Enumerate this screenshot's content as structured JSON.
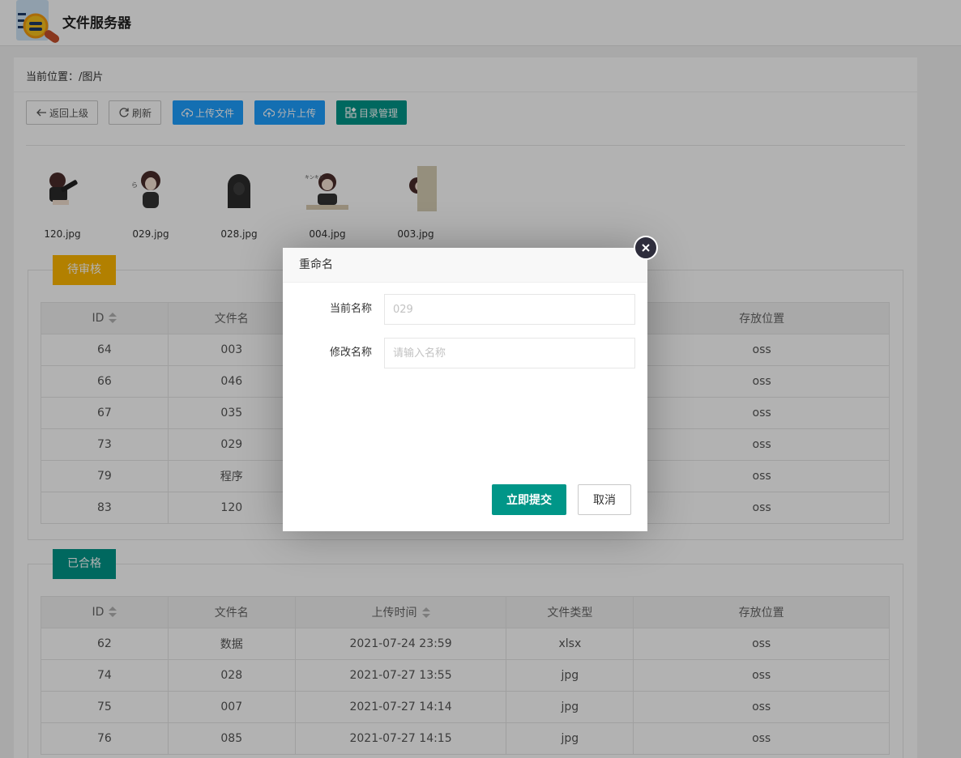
{
  "header": {
    "title": "文件服务器"
  },
  "breadcrumb": {
    "label": "当前位置：",
    "path": "/图片"
  },
  "toolbar": {
    "back": "返回上级",
    "refresh": "刷新",
    "upload": "上传文件",
    "chunk_upload": "分片上传",
    "dir_manage": "目录管理"
  },
  "thumbnails": [
    {
      "name": "120.jpg"
    },
    {
      "name": "029.jpg"
    },
    {
      "name": "028.jpg"
    },
    {
      "name": "004.jpg"
    },
    {
      "name": "003.jpg"
    }
  ],
  "pending": {
    "legend": "待审核",
    "columns": [
      "ID",
      "文件名",
      "存放位置"
    ],
    "rows": [
      {
        "id": "64",
        "name": "003",
        "location": "oss"
      },
      {
        "id": "66",
        "name": "046",
        "location": "oss"
      },
      {
        "id": "67",
        "name": "035",
        "location": "oss"
      },
      {
        "id": "73",
        "name": "029",
        "location": "oss"
      },
      {
        "id": "79",
        "name": "程序",
        "location": "oss"
      },
      {
        "id": "83",
        "name": "120",
        "location": "oss"
      }
    ]
  },
  "approved": {
    "legend": "已合格",
    "columns": [
      "ID",
      "文件名",
      "上传时间",
      "文件类型",
      "存放位置"
    ],
    "rows": [
      {
        "id": "62",
        "name": "数据",
        "time": "2021-07-24 23:59",
        "type": "xlsx",
        "location": "oss"
      },
      {
        "id": "74",
        "name": "028",
        "time": "2021-07-27 13:55",
        "type": "jpg",
        "location": "oss"
      },
      {
        "id": "75",
        "name": "007",
        "time": "2021-07-27 14:14",
        "type": "jpg",
        "location": "oss"
      },
      {
        "id": "76",
        "name": "085",
        "time": "2021-07-27 14:15",
        "type": "jpg",
        "location": "oss"
      }
    ]
  },
  "dialog": {
    "title": "重命名",
    "current_label": "当前名称",
    "current_placeholder": "029",
    "new_label": "修改名称",
    "new_placeholder": "请输入名称",
    "submit": "立即提交",
    "cancel": "取消"
  },
  "colors": {
    "accent_green": "#009688",
    "accent_blue": "#1e9fff",
    "accent_orange": "#ffb800"
  }
}
